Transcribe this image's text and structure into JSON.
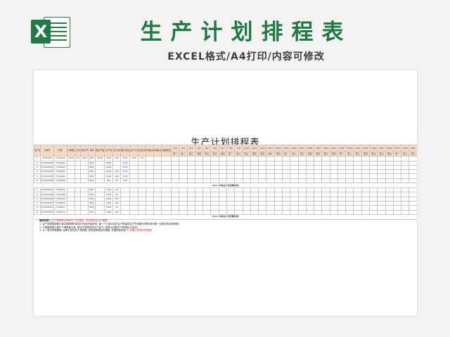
{
  "page": {
    "title": "生产计划排程表",
    "subtitle": "EXCEL格式/A4打印/内容可修改",
    "logo_letter": "X"
  },
  "sheet": {
    "title": "生产计划排程表",
    "columns": [
      "生产顺序",
      "订单号",
      "料号",
      "订单数量",
      "工时",
      "单位产能",
      "良率",
      "需生产数量",
      "生产批",
      "已计划产数",
      "需计划生产量",
      "生产工时",
      "完成日期",
      "开始日期",
      "延期日期",
      "延期原因"
    ],
    "day_headers": [
      "3/1",
      "3/2",
      "3/3",
      "3/4",
      "3/5",
      "3/6",
      "3/7",
      "3/8",
      "3/9",
      "3/10",
      "3/11",
      "3/12",
      "3/13",
      "3/14",
      "3/15",
      "3/16",
      "3/17",
      "3/18",
      "3/19",
      "3/20",
      "3/21",
      "3/22",
      "3/23",
      "3/24",
      "3/25",
      "3/26",
      "3/27",
      "3/28",
      "3/29",
      "3/30",
      "3/31"
    ],
    "weekdays": [
      "周一",
      "周二",
      "周三",
      "周四",
      "周五",
      "周六",
      "周日",
      "周一",
      "周二",
      "周三",
      "周四",
      "周五",
      "周六",
      "周日",
      "周一",
      "周二",
      "周三",
      "周四",
      "周五",
      "周六",
      "周日",
      "周一",
      "周二",
      "周三",
      "周四",
      "周五",
      "周六",
      "周日",
      "周一",
      "周二",
      "周三"
    ],
    "line_a": {
      "label": "Line 7A机台",
      "note": "(7月份满负荷)",
      "rows": [
        {
          "seq": "1",
          "order": "XFH5678",
          "part": "F100001",
          "qty": "3000",
          "hours": "3.8",
          "cap": "3000",
          "yield": "98%",
          "need": "9000",
          "batch": "1000",
          "planned": "100",
          "todo": "1000",
          "work": "3:00",
          "done": "3/1"
        },
        {
          "seq": "2",
          "order": "XF1000002",
          "part": "F100002",
          "qty": "",
          "hours": "",
          "cap": "",
          "yield": "98%",
          "need": "",
          "batch": "5000",
          "planned": "",
          "todo": "1000",
          "work": "",
          "done": ""
        },
        {
          "seq": "3",
          "order": "XF1000003",
          "part": "F100003",
          "qty": "",
          "hours": "",
          "cap": "",
          "yield": "98%",
          "need": "",
          "batch": "1000",
          "planned": "",
          "todo": "1000",
          "work": "",
          "done": ""
        },
        {
          "seq": "4",
          "order": "XF1000004",
          "part": "F100004",
          "qty": "",
          "hours": "",
          "cap": "",
          "yield": "98%",
          "need": "",
          "batch": "1000",
          "planned": "100",
          "todo": "1000",
          "work": "",
          "done": ""
        },
        {
          "seq": "5",
          "order": "XF1000005",
          "part": "F100005",
          "qty": "",
          "hours": "",
          "cap": "",
          "yield": "98%",
          "need": "",
          "batch": "1000",
          "planned": "100",
          "todo": "1000",
          "work": "",
          "done": ""
        },
        {
          "seq": "6",
          "order": "XF1000006",
          "part": "F100006",
          "qty": "",
          "hours": "",
          "cap": "",
          "yield": "98%",
          "need": "",
          "batch": "250",
          "planned": "45",
          "todo": "250",
          "work": "",
          "done": ""
        }
      ]
    },
    "line_b": {
      "label": "Line 7B机台",
      "note": "(7月份满负荷)",
      "rows": [
        {
          "seq": "1",
          "order": "XF1000007",
          "part": "F100007",
          "yield": "98%",
          "batch": "1100",
          "planned": "50"
        },
        {
          "seq": "2",
          "order": "XF1000008",
          "part": "F100008",
          "yield": "98%",
          "batch": "1100",
          "planned": "50"
        },
        {
          "seq": "3",
          "order": "XF1000009",
          "part": "F100009",
          "yield": "98%",
          "batch": "1000",
          "planned": "100"
        },
        {
          "seq": "4",
          "order": "XF1000010",
          "part": "F100010",
          "yield": "98%",
          "batch": "1000",
          "planned": "100"
        },
        {
          "seq": "5",
          "order": "XF1000011",
          "part": "F100011",
          "yield": "98%",
          "batch": "1000",
          "planned": "10"
        },
        {
          "seq": "6",
          "order": "XF1000012",
          "part": "F100012",
          "yield": "98%",
          "batch": "2000",
          "planned": "100"
        }
      ]
    },
    "line_c": {
      "label": "Line 7A机台",
      "note": "(7月份满负荷)"
    },
    "notes": {
      "head": "填表说明:",
      "head_red": "(生产排程表必须填写, 不可更改, 仅可按实际生产调整)",
      "line1": "1. 生产排程表按照订单交期和物料到位时间优先级排列, 每一个订单对应的生产数量和生产时间要写清楚(填写周一至周日的具体排程)",
      "line2": "2. 订单数量是以客户下单数量为准, 单位产能是实际生产能力, 良率为近期生产良率统计(按月)",
      "line3": "3. 以一周为排程周期, 每周五前完成下周排程, 如有插单需及时调整, 并通知相关部门",
      "line3_red": "(排程已完成后须签核)"
    }
  }
}
